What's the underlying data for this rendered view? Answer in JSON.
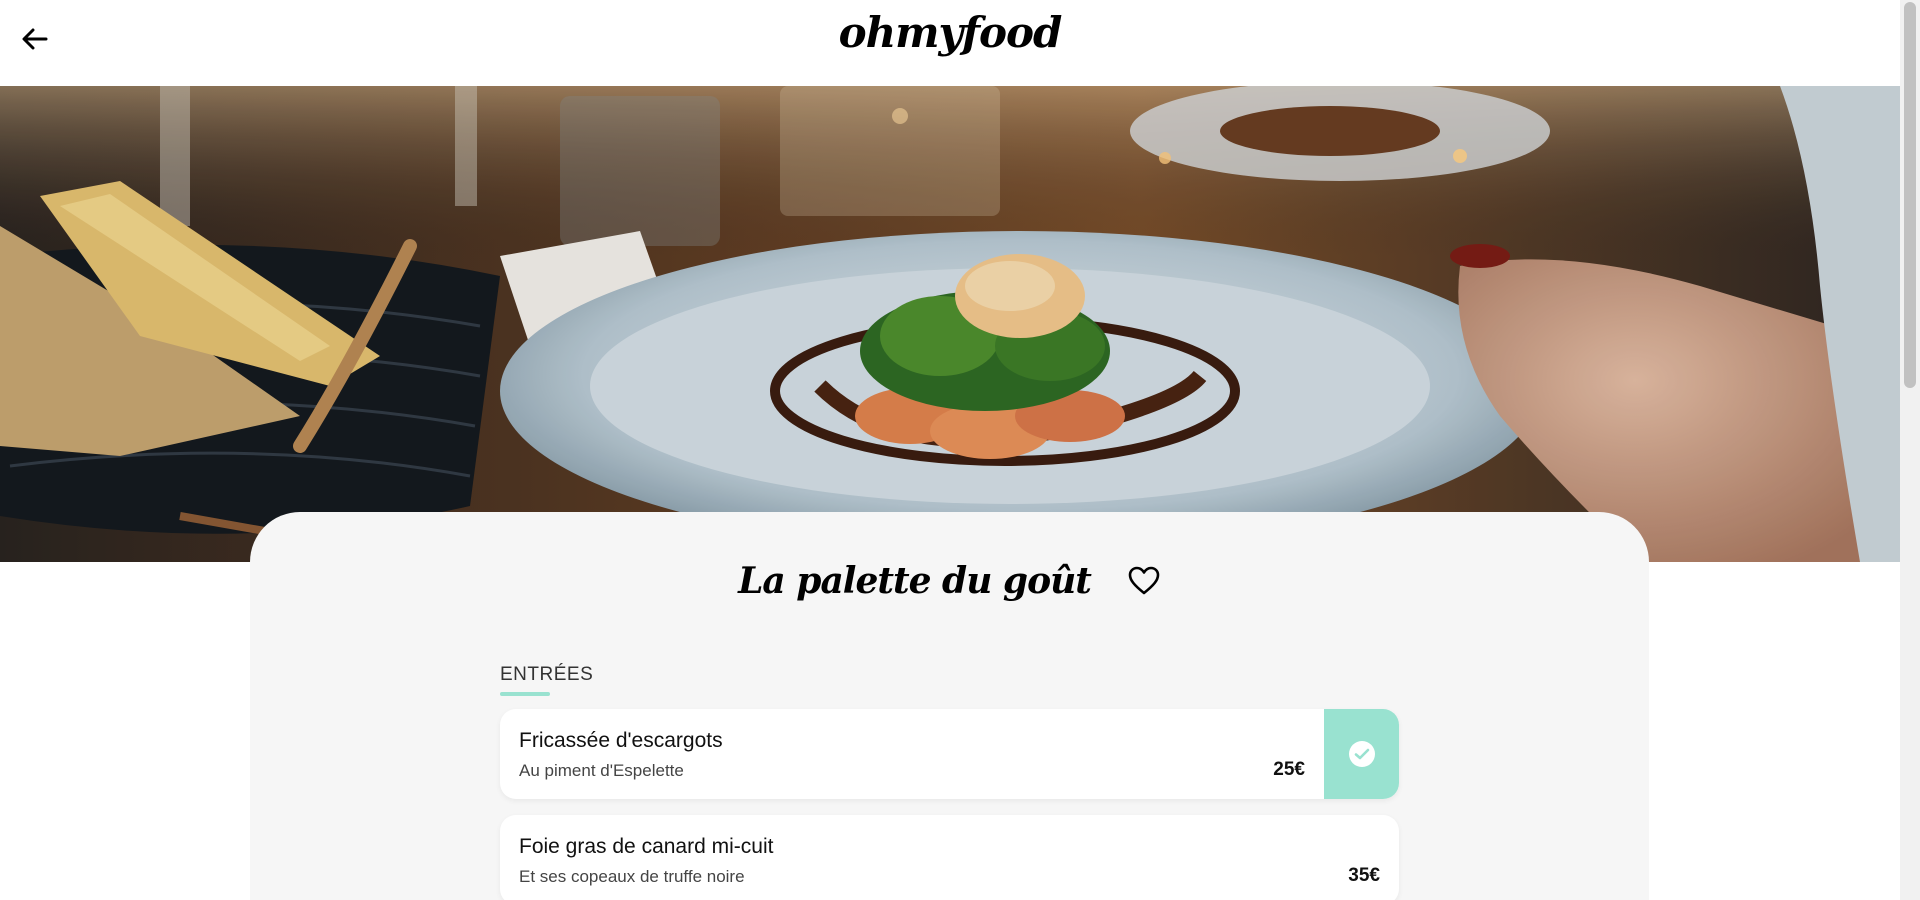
{
  "header": {
    "brand": "ohmyfood",
    "back_icon": "arrow-left-icon"
  },
  "hero": {
    "image": "plated-dish-photo"
  },
  "restaurant": {
    "name": "La palette du goût",
    "favorite_icon": "heart-outline-icon"
  },
  "menu": {
    "section_title": "ENTRÉES",
    "items": [
      {
        "name": "Fricassée d'escargots",
        "description": "Au piment d'Espelette",
        "price": "25€",
        "selected": true
      },
      {
        "name": "Foie gras de canard mi-cuit",
        "description": "Et ses copeaux de truffe noire",
        "price": "35€",
        "selected": false
      }
    ]
  },
  "colors": {
    "accent": "#99e2d0",
    "card_background": "#f6f6f6",
    "text": "#000000"
  }
}
